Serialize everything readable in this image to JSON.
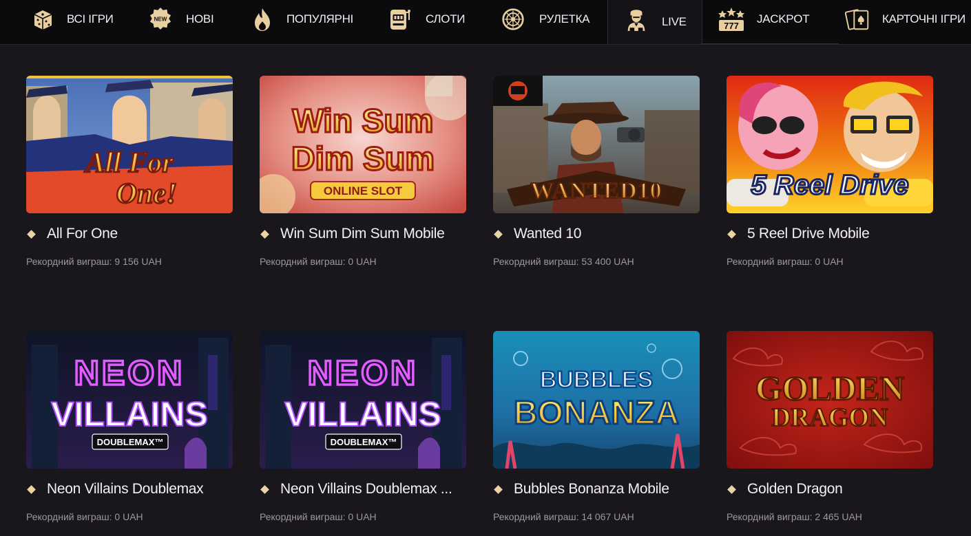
{
  "nav": {
    "items": [
      {
        "label": "ВСІ ІГРИ",
        "icon": "dice-icon"
      },
      {
        "label": "НОВІ",
        "icon": "new-badge-icon",
        "badge": "NEW"
      },
      {
        "label": "ПОПУЛЯРНІ",
        "icon": "flame-icon"
      },
      {
        "label": "СЛОТИ",
        "icon": "slot-machine-icon"
      },
      {
        "label": "РУЛЕТКА",
        "icon": "roulette-icon"
      },
      {
        "label": "LIVE",
        "icon": "live-dealer-icon",
        "active": true
      },
      {
        "label": "JACKPOT",
        "icon": "jackpot-777-icon",
        "badge": "777"
      },
      {
        "label": "КАРТОЧНІ ІГРИ",
        "icon": "cards-icon"
      }
    ]
  },
  "games": [
    {
      "title": "All For One",
      "record": "Рекордний виграш: 9 156 UAH",
      "art": [
        "All For",
        "One!"
      ]
    },
    {
      "title": "Win Sum Dim Sum Mobile",
      "record": "Рекордний виграш: 0 UAH",
      "art": [
        "Win Sum",
        "Dim Sum",
        "ONLINE SLOT"
      ]
    },
    {
      "title": "Wanted 10",
      "record": "Рекордний виграш: 53 400 UAH",
      "art": [
        "WANTED10"
      ]
    },
    {
      "title": "5 Reel Drive Mobile",
      "record": "Рекордний виграш: 0 UAH",
      "art": [
        "5 Reel Drive"
      ]
    },
    {
      "title": "Neon Villains Doublemax",
      "record": "Рекордний виграш: 0 UAH",
      "art": [
        "NEON",
        "VILLAINS",
        "DOUBLEMAX™"
      ]
    },
    {
      "title": "Neon Villains Doublemax ...",
      "record": "Рекордний виграш: 0 UAH",
      "art": [
        "NEON",
        "VILLAINS",
        "DOUBLEMAX™"
      ]
    },
    {
      "title": "Bubbles Bonanza Mobile",
      "record": "Рекордний виграш: 14 067 UAH",
      "art": [
        "BUBBLES",
        "BONANZA"
      ]
    },
    {
      "title": "Golden Dragon",
      "record": "Рекордний виграш: 2 465 UAH",
      "art": [
        "GOLDEN",
        "DRAGON"
      ]
    }
  ],
  "colors": {
    "accent": "#ead3a5",
    "background": "#1a171c",
    "nav_background": "#0b0a0c",
    "muted_text": "#9b989e"
  }
}
